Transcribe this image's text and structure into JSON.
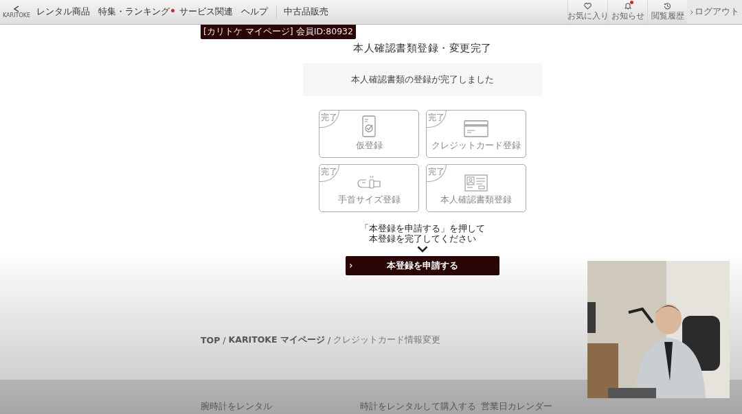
{
  "header": {
    "logo": "KARITOKE",
    "nav": [
      {
        "label": "レンタル商品",
        "dot": false
      },
      {
        "label": "特集・ランキング",
        "dot": true
      },
      {
        "label": "サービス関連",
        "dot": false
      },
      {
        "label": "ヘルプ",
        "dot": false
      }
    ],
    "nav_secondary": "中古品販売",
    "icon_buttons": [
      {
        "kind": "heart",
        "label": "お気に入り",
        "badge": false
      },
      {
        "kind": "bell",
        "label": "お知らせ",
        "badge": true
      },
      {
        "kind": "history",
        "label": "閲覧履歴",
        "badge": false
      }
    ],
    "logout": "ログアウト"
  },
  "member_badge": "[カリトケ マイページ] 会員ID:80932",
  "title": "本人確認書類登録・変更完了",
  "message": "本人確認書類の登録が完了しました",
  "steps": [
    {
      "kind": "phone",
      "status": "完了",
      "label": "仮登録"
    },
    {
      "kind": "card",
      "status": "完了",
      "label": "クレジットカード登録"
    },
    {
      "kind": "wrist",
      "status": "完了",
      "label": "手首サイズ登録"
    },
    {
      "kind": "id",
      "status": "完了",
      "label": "本人確認書類登録"
    }
  ],
  "instruction": [
    "「本登録を申請する」を押して",
    "本登録を完了してください"
  ],
  "submit_button": "本登録を申請する",
  "breadcrumb": {
    "separator": "/",
    "items": [
      "TOP",
      "KARITOKE マイページ",
      "クレジットカード情報変更"
    ]
  },
  "footer_headings": [
    "腕時計をレンタル",
    "時計をレンタルして購入する",
    "営業日カレンダー"
  ],
  "video_overlay": {
    "kind": "picture"
  }
}
